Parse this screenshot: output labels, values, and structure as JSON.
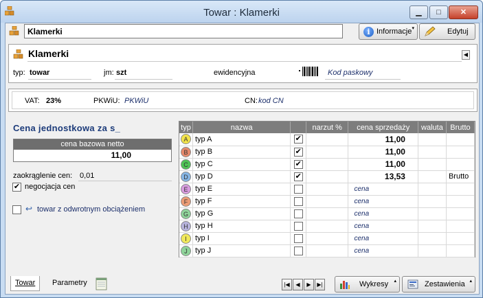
{
  "window": {
    "title": "Towar : Klamerki",
    "min": "▁",
    "max": "□",
    "close": "✕"
  },
  "header": {
    "name": "Klamerki",
    "info_label": "Informacje",
    "edit_label": "Edytuj"
  },
  "details": {
    "name": "Klamerki",
    "typ_label": "typ:",
    "typ_value": "towar",
    "jm_label": "jm:",
    "jm_value": "szt",
    "ewidencyjna_label": "ewidencyjna",
    "barcode_placeholder": "Kod paskowy"
  },
  "tax": {
    "vat_label": "VAT:",
    "vat_value": "23%",
    "pkwiu_label": "PKWiU:",
    "pkwiu_value": "PKWiU",
    "cn_label": "CN:",
    "cn_value": "kod CN"
  },
  "left": {
    "section_title": "Cena jednostkowa za s_",
    "base_price_header": "cena bazowa netto",
    "base_price_value": "11,00",
    "rounding_label": "zaokrąglenie cen:",
    "rounding_value": "0,01",
    "negotiation_label": "negocjacja cen",
    "negotiation_checked": "✔",
    "reverse_charge_label": "towar z odwrotnym obciążeniem"
  },
  "price_table": {
    "headers": [
      "typ",
      "nazwa",
      "",
      "narzut %",
      "cena sprzedaży",
      "waluta",
      "Brutto"
    ],
    "rows": [
      {
        "badge": "A",
        "color": "#f2e34a",
        "name": "typ A",
        "checked": "✔",
        "price": "11,00",
        "brutto": ""
      },
      {
        "badge": "B",
        "color": "#e8896b",
        "name": "typ B",
        "checked": "✔",
        "price": "11,00",
        "brutto": ""
      },
      {
        "badge": "C",
        "color": "#4fc457",
        "name": "typ C",
        "checked": "✔",
        "price": "11,00",
        "brutto": ""
      },
      {
        "badge": "D",
        "color": "#86b6e6",
        "name": "typ D",
        "checked": "✔",
        "price": "13,53",
        "brutto": "Brutto"
      },
      {
        "badge": "E",
        "color": "#d99ce0",
        "name": "typ E",
        "checked": "",
        "price": "cena",
        "brutto": ""
      },
      {
        "badge": "F",
        "color": "#ec9c76",
        "name": "typ F",
        "checked": "",
        "price": "cena",
        "brutto": ""
      },
      {
        "badge": "G",
        "color": "#8fd49a",
        "name": "typ G",
        "checked": "",
        "price": "cena",
        "brutto": ""
      },
      {
        "badge": "H",
        "color": "#b7b3dc",
        "name": "typ H",
        "checked": "",
        "price": "cena",
        "brutto": ""
      },
      {
        "badge": "I",
        "color": "#f0e85a",
        "name": "typ I",
        "checked": "",
        "price": "cena",
        "brutto": ""
      },
      {
        "badge": "J",
        "color": "#8fd49a",
        "name": "typ J",
        "checked": "",
        "price": "cena",
        "brutto": ""
      }
    ]
  },
  "footer": {
    "tab_towar": "Towar",
    "tab_parametry": "Parametry",
    "nav_first": "|◀",
    "nav_prev": "◀",
    "nav_next": "▶",
    "nav_last": "▶|",
    "wykresy_label": "Wykresy",
    "zestawienia_label": "Zestawienia"
  }
}
